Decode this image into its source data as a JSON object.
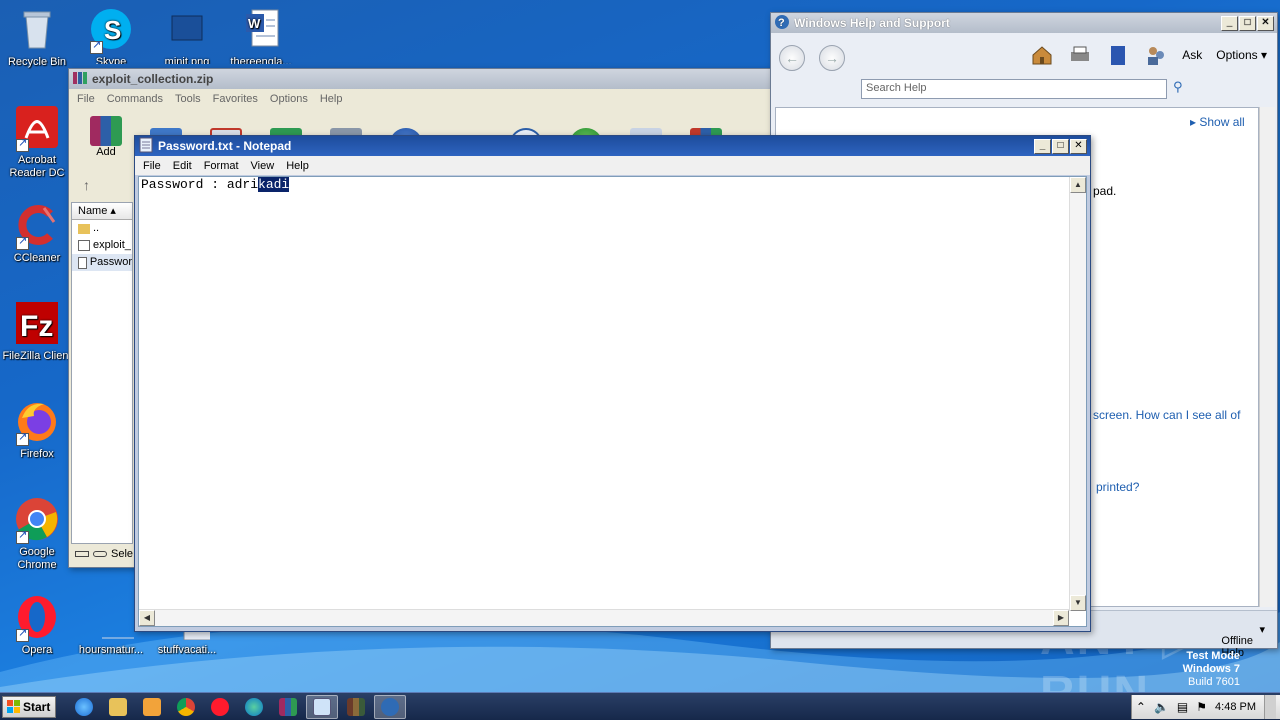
{
  "desktop": {
    "icons": [
      {
        "label": "Recycle Bin",
        "icon": "recycle-bin-icon"
      },
      {
        "label": "Skype",
        "icon": "skype-icon"
      },
      {
        "label": "minit.png",
        "icon": "image-file-icon"
      },
      {
        "label": "thereengla...",
        "icon": "word-doc-icon"
      },
      {
        "label": "Acrobat Reader DC",
        "icon": "acrobat-icon"
      },
      {
        "label": "CCleaner",
        "icon": "ccleaner-icon"
      },
      {
        "label": "FileZilla Client",
        "icon": "filezilla-icon"
      },
      {
        "label": "Firefox",
        "icon": "firefox-icon"
      },
      {
        "label": "Google Chrome",
        "icon": "chrome-icon"
      },
      {
        "label": "Opera",
        "icon": "opera-icon"
      },
      {
        "label": "hoursmatur...",
        "icon": "file-icon"
      },
      {
        "label": "stuffvacati...",
        "icon": "file-icon"
      }
    ]
  },
  "winrar": {
    "title": "exploit_collection.zip",
    "menu": [
      "File",
      "Commands",
      "Tools",
      "Favorites",
      "Options",
      "Help"
    ],
    "toolbar": {
      "add_label": "Add"
    },
    "file_list": {
      "header": "Name",
      "rows": [
        "..",
        "exploit_",
        "Passwor"
      ]
    },
    "status": "Sele"
  },
  "help": {
    "title": "Windows Help and Support",
    "ask_label": "Ask",
    "options_label": "Options",
    "search_placeholder": "Search Help",
    "show_all": "Show all",
    "fragments": {
      "pad": "pad.",
      "screen": "screen. How can I see all of",
      "printed": "printed?"
    },
    "footer": "Offline Help"
  },
  "notepad": {
    "title": "Password.txt - Notepad",
    "menu": [
      "File",
      "Edit",
      "Format",
      "View",
      "Help"
    ],
    "text_before": "Password : adri",
    "text_selected": "kadi"
  },
  "taskbar": {
    "start_label": "Start",
    "clock": "4:48 PM"
  },
  "watermark": {
    "line1": "Test Mode",
    "line2": "Windows 7",
    "line3": "Build 7601"
  },
  "colors": {
    "desktop": "#1668c9",
    "notepad_title": "#1d4c9c",
    "selection": "#0a246a",
    "link": "#1f5fb0"
  }
}
